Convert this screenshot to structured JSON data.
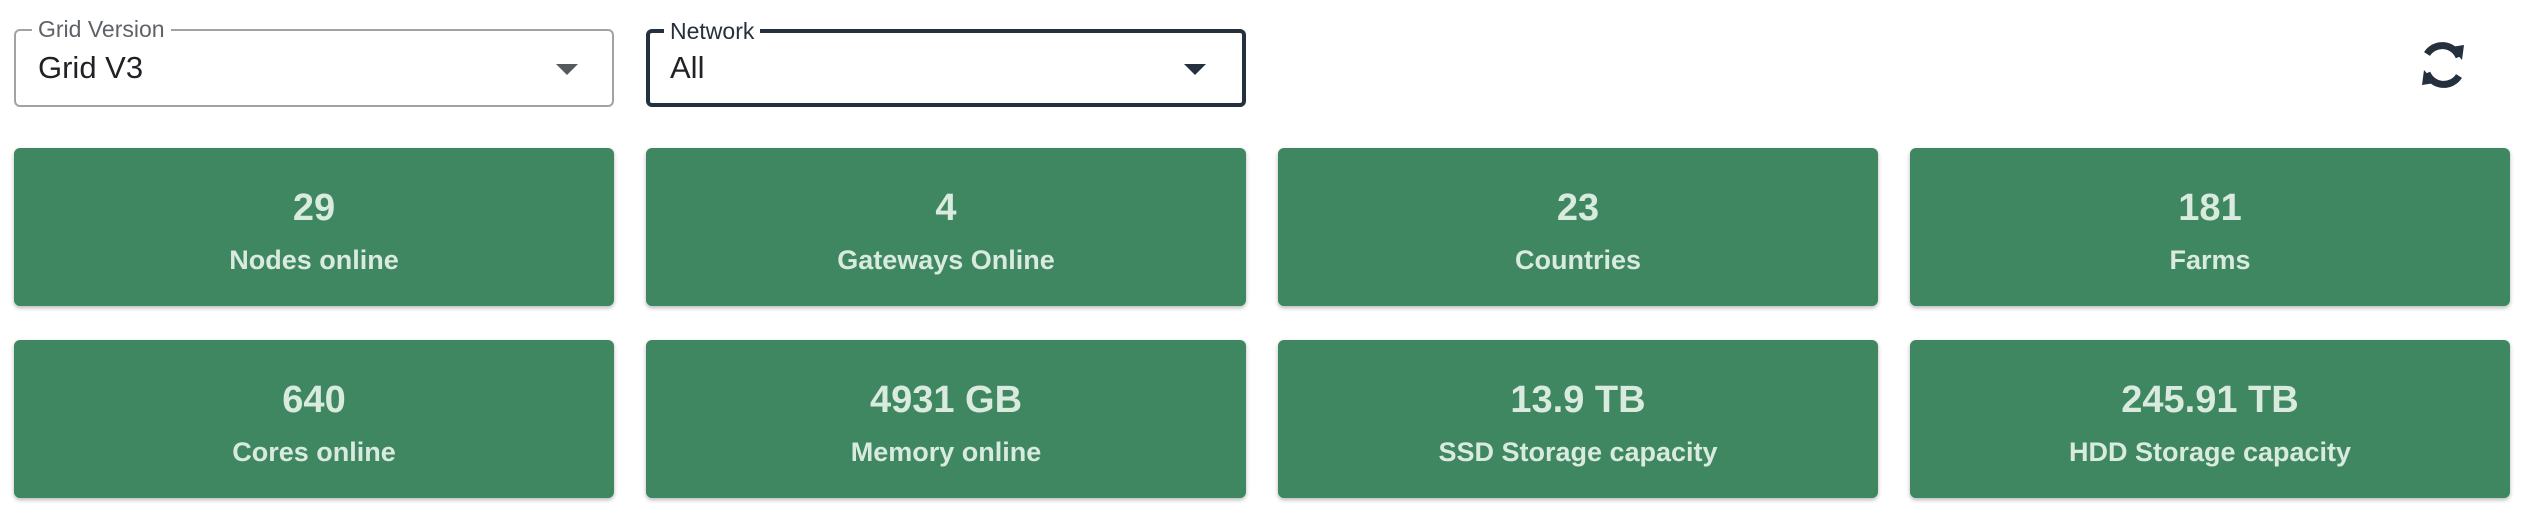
{
  "filters": {
    "grid_version": {
      "label": "Grid Version",
      "value": "Grid V3"
    },
    "network": {
      "label": "Network",
      "value": "All"
    }
  },
  "toolbar": {
    "refresh_icon": "refresh-icon"
  },
  "stats": [
    {
      "value": "29",
      "label": "Nodes online"
    },
    {
      "value": "4",
      "label": "Gateways Online"
    },
    {
      "value": "23",
      "label": "Countries"
    },
    {
      "value": "181",
      "label": "Farms"
    },
    {
      "value": "640",
      "label": "Cores online"
    },
    {
      "value": "4931 GB",
      "label": "Memory online"
    },
    {
      "value": "13.9 TB",
      "label": "SSD Storage capacity"
    },
    {
      "value": "245.91 TB",
      "label": "HDD Storage capacity"
    }
  ],
  "colors": {
    "card_background": "#3f8760",
    "card_text": "#d9eadf",
    "focused_border": "#24303d"
  }
}
